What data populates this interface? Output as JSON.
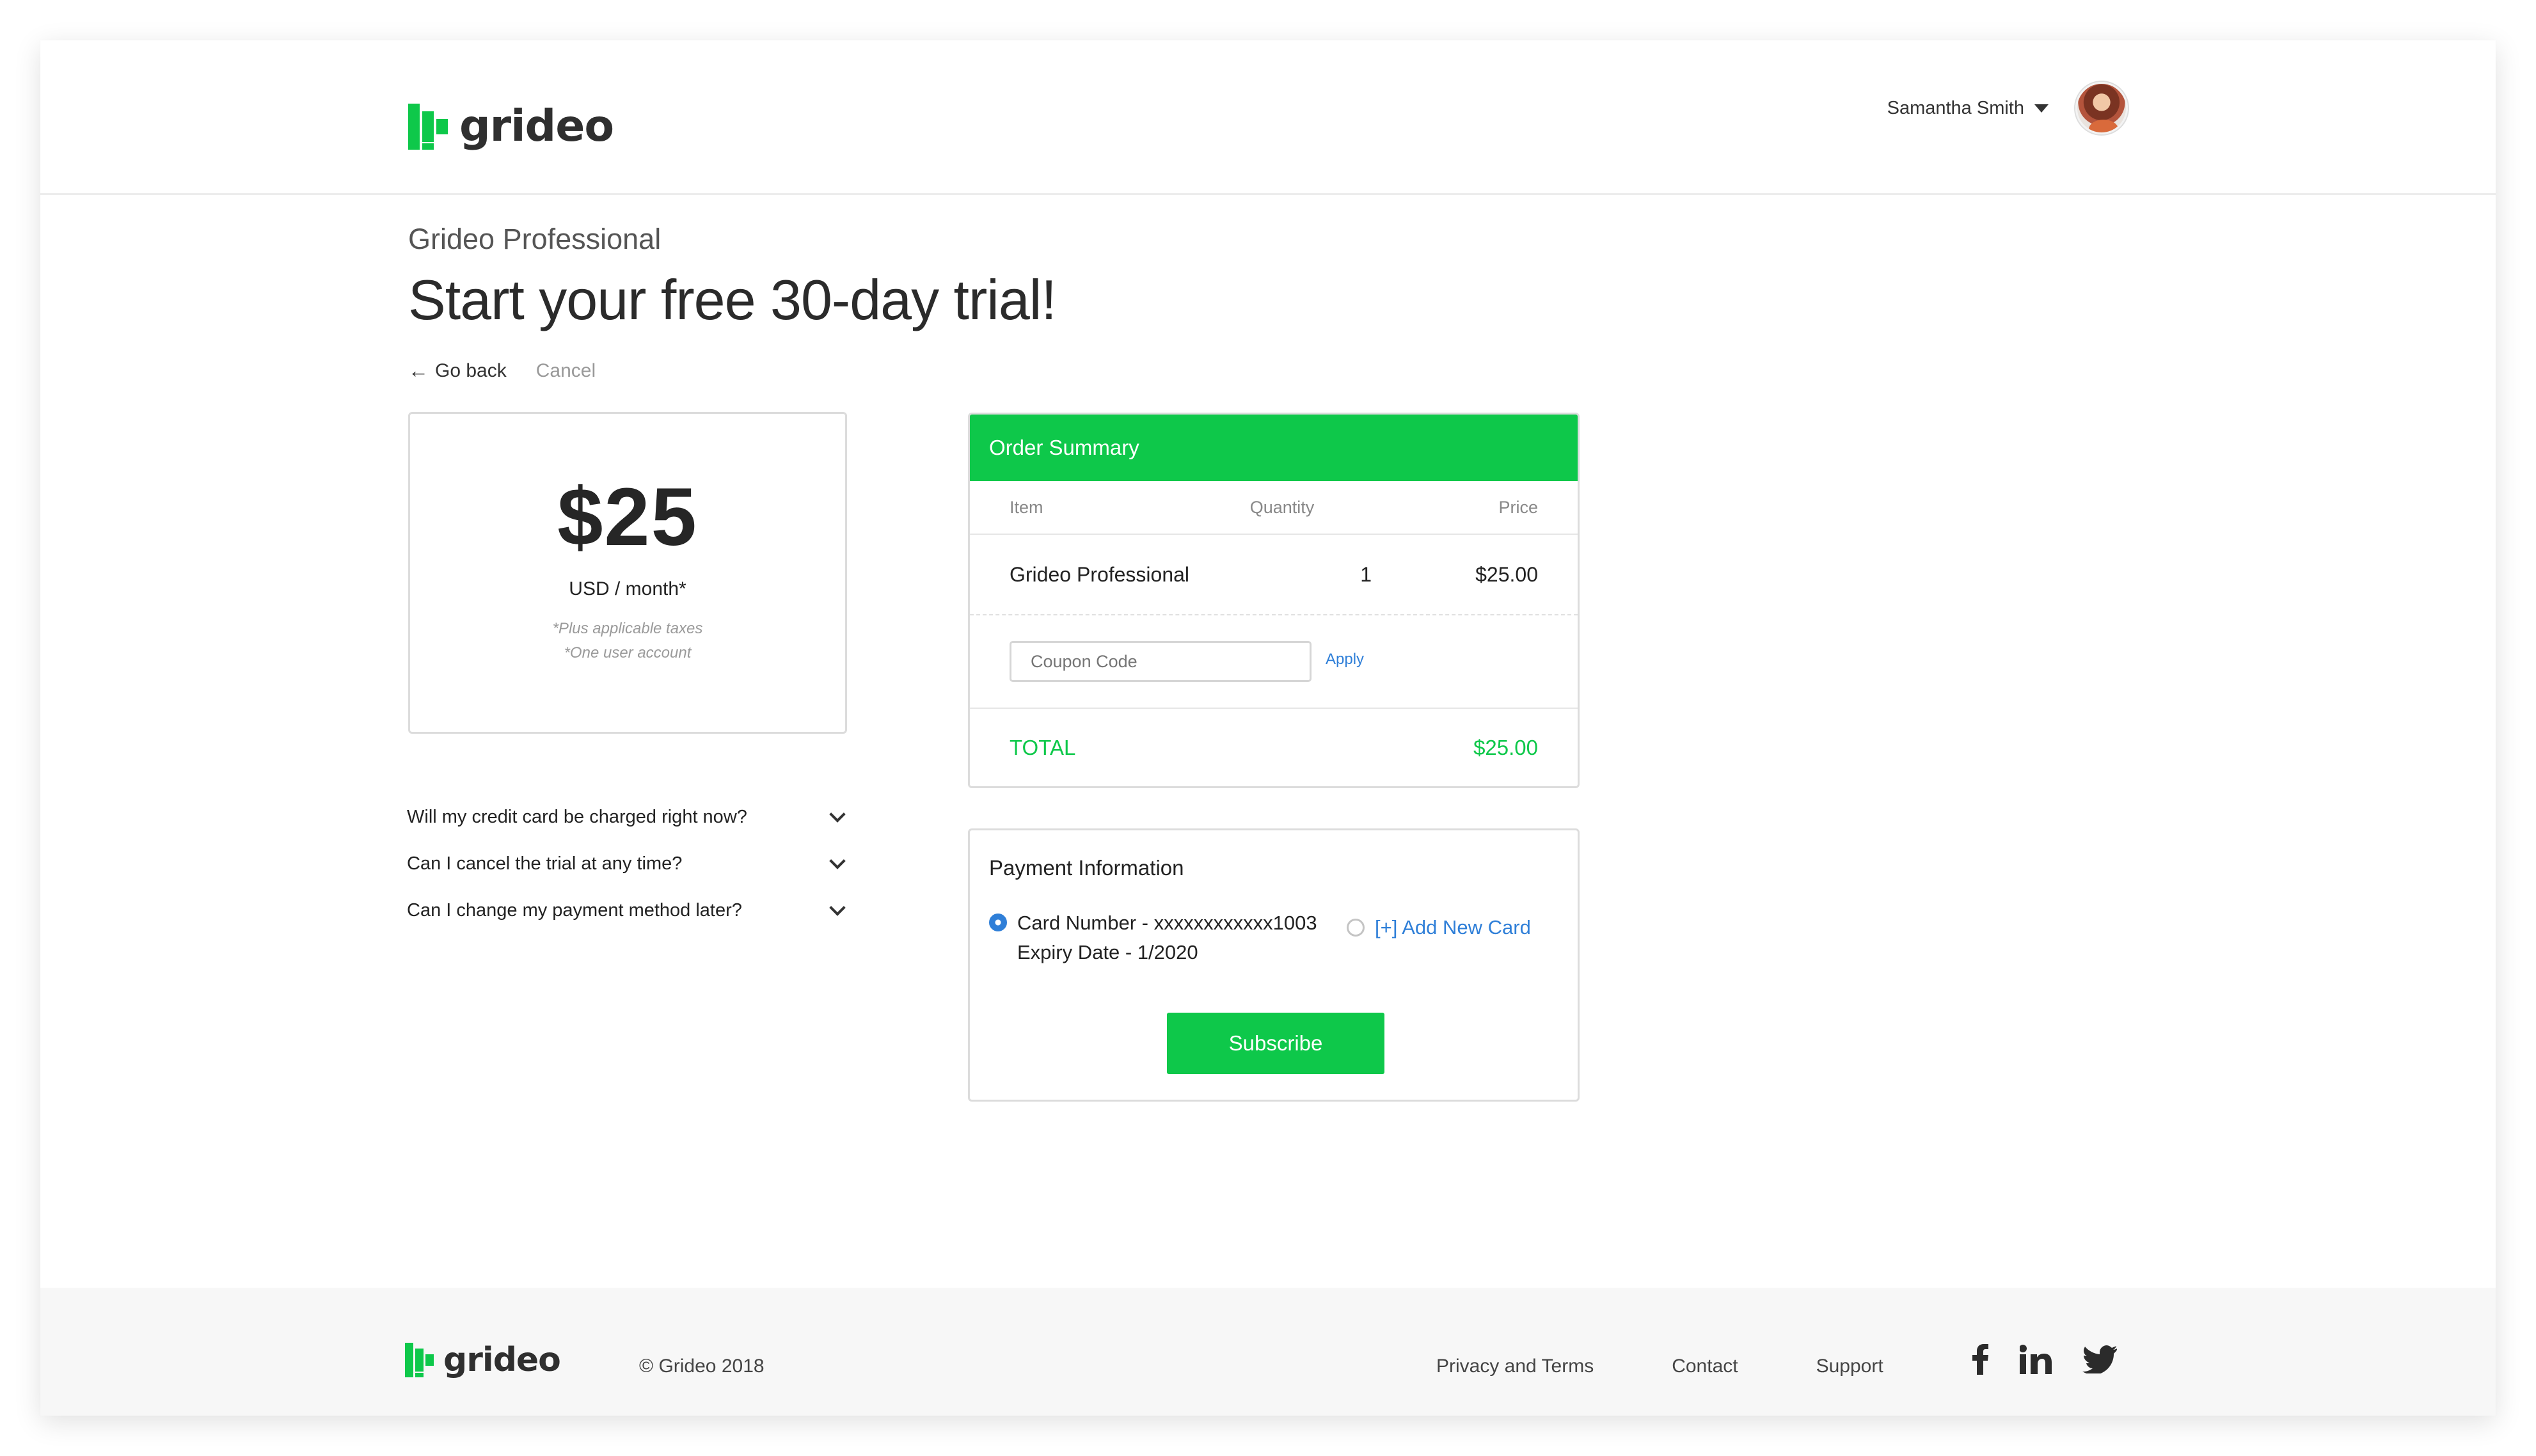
{
  "brand": {
    "name": "grideo",
    "accent": "#0ec84a",
    "link_color": "#2f7fd8"
  },
  "header": {
    "user_name": "Samantha Smith"
  },
  "page": {
    "subtitle": "Grideo Professional",
    "title": "Start your free 30-day trial!",
    "back_label": "Go back",
    "cancel_label": "Cancel"
  },
  "price_card": {
    "amount": "$25",
    "unit": "USD / month*",
    "note_taxes": "*Plus applicable taxes",
    "note_account": "*One user account"
  },
  "faq": [
    {
      "question": "Will my credit card be charged right now?"
    },
    {
      "question": "Can I cancel the trial at any time?"
    },
    {
      "question": "Can I change my payment method later?"
    }
  ],
  "order": {
    "heading": "Order Summary",
    "columns": {
      "item": "Item",
      "quantity": "Quantity",
      "price": "Price"
    },
    "row": {
      "item": "Grideo Professional",
      "quantity": "1",
      "price": "$25.00"
    },
    "coupon_placeholder": "Coupon Code",
    "apply_label": "Apply",
    "total_label": "TOTAL",
    "total_value": "$25.00"
  },
  "payment": {
    "heading": "Payment Information",
    "card_number_line": "Card Number - xxxxxxxxxxxx1003",
    "expiry_line": "Expiry Date - 1/2020",
    "add_card_label": "[+] Add New Card",
    "subscribe_label": "Subscribe"
  },
  "footer": {
    "copyright": "© Grideo 2018",
    "links": [
      "Privacy and Terms",
      "Contact",
      "Support"
    ],
    "social_icons": [
      "facebook-icon",
      "linkedin-icon",
      "twitter-icon"
    ]
  }
}
